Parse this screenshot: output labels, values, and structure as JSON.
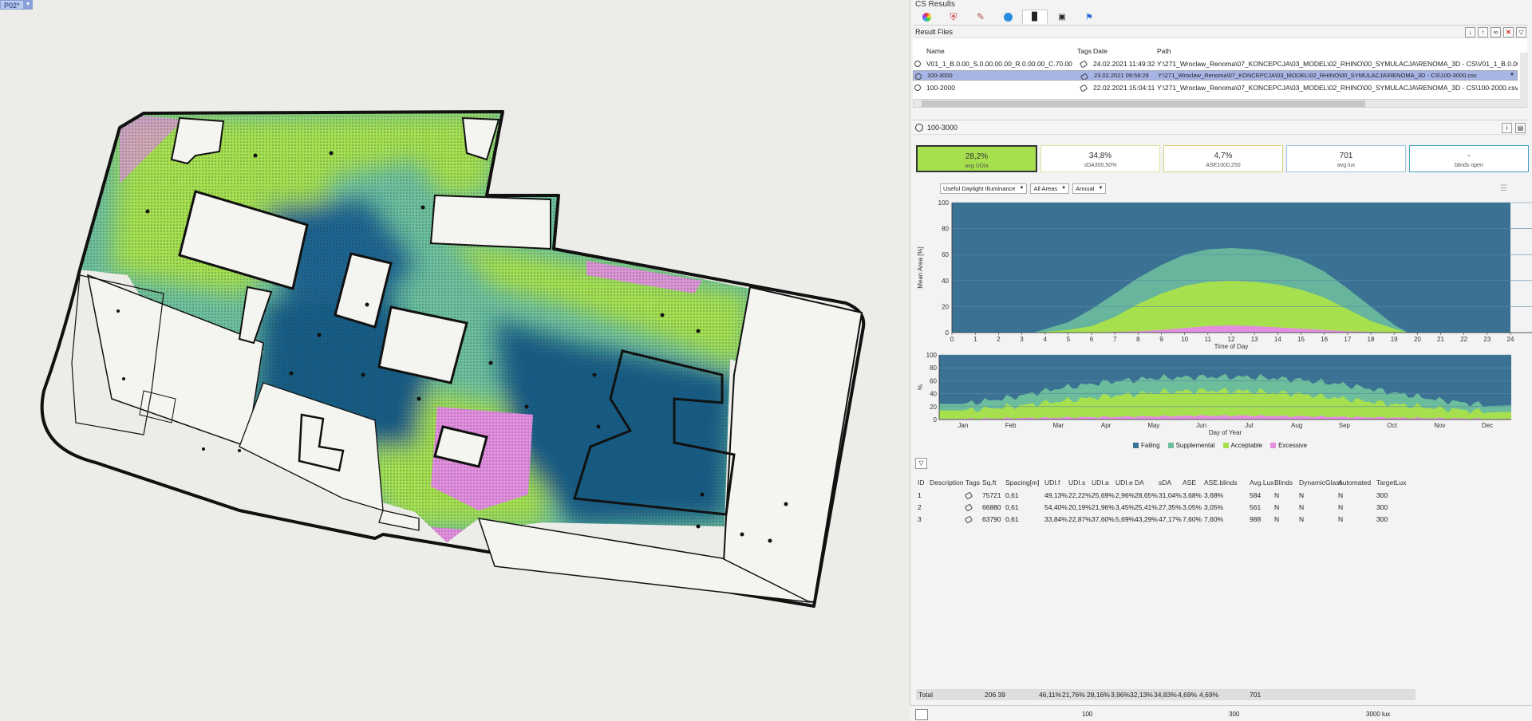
{
  "viewport": {
    "tag": "P02*"
  },
  "panel": {
    "title": "CS Results",
    "tabs": [
      "color-wheel-icon",
      "shield-icon",
      "brush-icon",
      "circle-g-icon",
      "bar-chart-icon",
      "camera-icon",
      "bell-icon"
    ],
    "result_files": {
      "title": "Result Files",
      "tools": [
        "download-icon",
        "export-icon",
        "link-icon",
        "close-icon",
        "filter-icon"
      ],
      "columns": [
        "Name",
        "Tags",
        "Date",
        "Path"
      ],
      "rows": [
        {
          "name": "V01_1_B.0.00_S.0.00.00.00_R.0.00.00_C.70.00",
          "date": "24.02.2021 11:49:32",
          "path": "Y:\\271_Wroclaw_Renoma\\07_KONCEPCJA\\03_MODEL\\02_RHINO\\00_SYMULACJA\\RENOMA_3D - CS\\V01_1_B.0.00_"
        },
        {
          "name": "100-3000",
          "date": "23.02.2021 09:58:28",
          "path": "Y:\\271_Wroclaw_Renoma\\07_KONCEPCJA\\03_MODEL\\02_RHINO\\00_SYMULACJA\\RENOMA_3D - CS\\100-3000.csv",
          "selected": true
        },
        {
          "name": "100-2000",
          "date": "22.02.2021 15:04:11",
          "path": "Y:\\271_Wroclaw_Renoma\\07_KONCEPCJA\\03_MODEL\\02_RHINO\\00_SYMULACJA\\RENOMA_3D - CS\\100-2000.csv"
        }
      ]
    },
    "result": {
      "name": "100-3000",
      "metrics": [
        {
          "value": "28,2%",
          "label": "avg UDIa"
        },
        {
          "value": "34,8%",
          "label": "sDA300,50%"
        },
        {
          "value": "4,7%",
          "label": "ASE1000,250"
        },
        {
          "value": "701",
          "label": "avg lux"
        },
        {
          "value": "-",
          "label": "blinds open"
        }
      ],
      "filters": [
        "Useful Daylight Illuminance",
        "All Areas",
        "Annual"
      ]
    },
    "legend": [
      {
        "name": "Failing",
        "color": "#3b7294"
      },
      {
        "name": "Supplemental",
        "color": "#6cbd9c"
      },
      {
        "name": "Acceptable",
        "color": "#a6e04f"
      },
      {
        "name": "Excessive",
        "color": "#e48ee0"
      }
    ],
    "table": {
      "columns": [
        "ID",
        "Description",
        "Tags",
        "Sq.ft",
        "Spacing[m]",
        "UDI.f",
        "UDI.s",
        "UDI.a",
        "UDI.e",
        "DA",
        "sDA",
        "ASE",
        "ASE.blinds",
        "Avg.Lux",
        "Blinds",
        "DynamicGlass",
        "Automated",
        "TargetLux"
      ],
      "rows": [
        [
          "1",
          "",
          "",
          "75721",
          "0,61",
          "49,13%",
          "22,22%",
          "25,69%",
          "2,96%",
          "28,65%",
          "31,04%",
          "3,68%",
          "3,68%",
          "584",
          "N",
          "N",
          "N",
          "300"
        ],
        [
          "2",
          "",
          "",
          "66880",
          "0,61",
          "54,40%",
          "20,19%",
          "21,96%",
          "3,45%",
          "25,41%",
          "27,35%",
          "3,05%",
          "3,05%",
          "561",
          "N",
          "N",
          "N",
          "300"
        ],
        [
          "3",
          "",
          "",
          "63790",
          "0,61",
          "33,84%",
          "22,87%",
          "37,60%",
          "5,69%",
          "43,29%",
          "47,17%",
          "7,60%",
          "7,60%",
          "988",
          "N",
          "N",
          "N",
          "300"
        ]
      ],
      "total": [
        "Total",
        "206 39",
        "46,11%",
        "21,76%",
        "28,16%",
        "3,96%",
        "32,13%",
        "34,83%",
        "4,69%",
        "4,69%",
        "701"
      ]
    },
    "bottom": {
      "min": "100",
      "mid": "300",
      "max": "3000 lux"
    }
  },
  "chart_data": [
    {
      "type": "area",
      "xlabel": "Time of Day",
      "ylabel": "Mean Area [%]",
      "xlim": [
        0,
        24
      ],
      "ylim": [
        0,
        100
      ],
      "xticks": [
        0,
        1,
        2,
        3,
        4,
        5,
        6,
        7,
        8,
        9,
        10,
        11,
        12,
        13,
        14,
        15,
        16,
        17,
        18,
        19,
        20,
        21,
        22,
        23,
        24
      ],
      "yticks": [
        0,
        20,
        40,
        60,
        80,
        100
      ],
      "x": [
        3.5,
        5,
        6,
        7,
        8,
        9,
        10,
        11,
        12,
        13,
        14,
        15,
        16,
        17,
        18,
        19,
        19.6
      ],
      "series": [
        {
          "name": "Excessive",
          "values": [
            0,
            0,
            0,
            0.5,
            1,
            2,
            3.5,
            5,
            5.5,
            5,
            4,
            3,
            2,
            1,
            0.5,
            0,
            0
          ]
        },
        {
          "name": "Acceptable",
          "values": [
            0,
            2,
            5,
            12,
            22,
            30,
            36,
            39,
            40,
            39,
            37,
            33,
            27,
            18,
            9,
            3,
            0
          ]
        },
        {
          "name": "Supplemental",
          "values": [
            0,
            8,
            18,
            30,
            42,
            52,
            60,
            64,
            65,
            64,
            61,
            56,
            47,
            34,
            20,
            6,
            0
          ]
        },
        {
          "name": "Failing",
          "values": [
            100,
            100,
            100,
            100,
            100,
            100,
            100,
            100,
            100,
            100,
            100,
            100,
            100,
            100,
            100,
            100,
            100
          ]
        }
      ],
      "grid": true
    },
    {
      "type": "area",
      "xlabel": "Day of Year",
      "ylabel": "%",
      "ylim": [
        0,
        100
      ],
      "yticks": [
        0,
        20,
        40,
        60,
        80,
        100
      ],
      "categories": [
        "Jan",
        "Feb",
        "Mar",
        "Apr",
        "May",
        "Jun",
        "Jul",
        "Aug",
        "Sep",
        "Oct",
        "Nov",
        "Dec"
      ],
      "series": [
        {
          "name": "Excessive",
          "values": [
            1,
            2,
            3,
            4,
            5,
            6,
            6,
            5,
            4,
            3,
            2,
            1
          ]
        },
        {
          "name": "Acceptable",
          "values": [
            14,
            20,
            28,
            36,
            42,
            45,
            44,
            40,
            32,
            24,
            17,
            12
          ]
        },
        {
          "name": "Supplemental",
          "values": [
            24,
            34,
            48,
            58,
            64,
            66,
            66,
            62,
            54,
            42,
            30,
            22
          ]
        },
        {
          "name": "Failing",
          "values": [
            100,
            100,
            100,
            100,
            100,
            100,
            100,
            100,
            100,
            100,
            100,
            100
          ]
        }
      ],
      "grid": true
    }
  ]
}
